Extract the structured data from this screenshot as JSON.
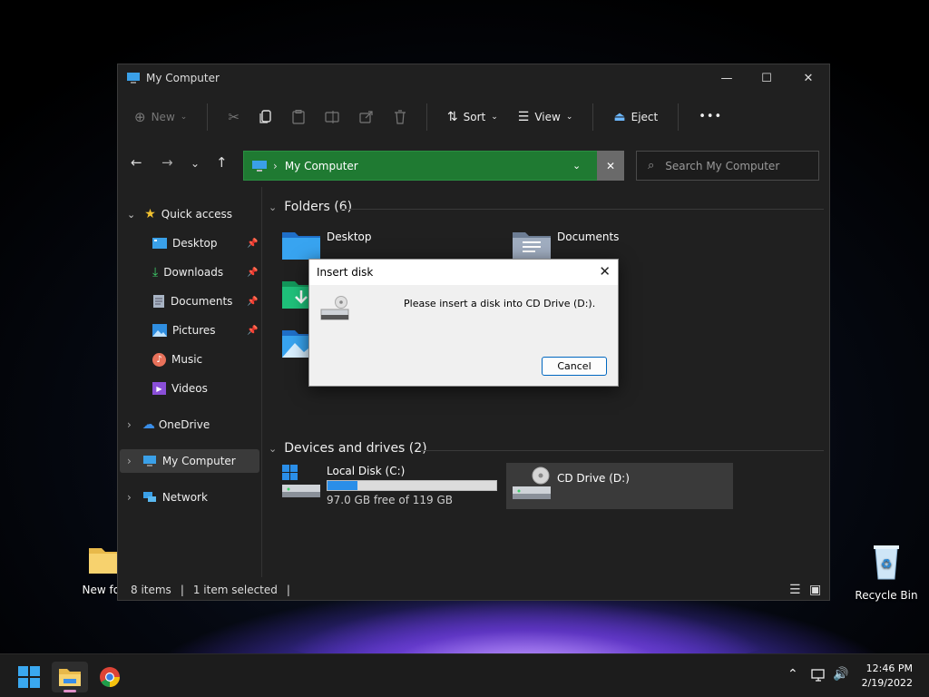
{
  "window": {
    "title": "My Computer"
  },
  "toolbar": {
    "new_label": "New",
    "sort_label": "Sort",
    "view_label": "View",
    "eject_label": "Eject",
    "more_label": "•••"
  },
  "address": {
    "path": "My Computer",
    "clear_label": "✕",
    "search_placeholder": "Search My Computer"
  },
  "sidebar": {
    "quick_access": "Quick access",
    "items": [
      "Desktop",
      "Downloads",
      "Documents",
      "Pictures",
      "Music",
      "Videos"
    ],
    "onedrive": "OneDrive",
    "my_computer": "My Computer",
    "network": "Network"
  },
  "main": {
    "folders_header": "Folders (6)",
    "folder_desktop": "Desktop",
    "folder_documents": "Documents",
    "devices_header": "Devices and drives (2)",
    "local_disk": {
      "name": "Local Disk (C:)",
      "free": "97.0 GB free of 119 GB",
      "used_fraction": 0.18
    },
    "cd_drive": {
      "name": "CD Drive (D:)"
    }
  },
  "status": {
    "items": "8 items",
    "selected": "1 item selected"
  },
  "dialog": {
    "title": "Insert disk",
    "message": "Please insert a disk into CD Drive (D:).",
    "cancel_label": "Cancel"
  },
  "desktop": {
    "new_folder": "New fol",
    "recycle_bin": "Recycle Bin"
  },
  "taskbar": {
    "time": "12:46 PM",
    "date": "2/19/2022"
  }
}
